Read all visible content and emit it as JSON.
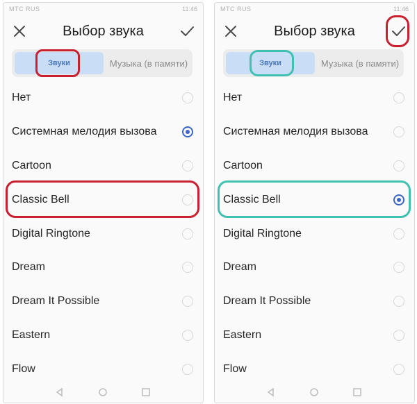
{
  "colors": {
    "accent_blue": "#3a66c9",
    "highlight_red": "#c8202f",
    "highlight_teal": "#3fc0b0",
    "tab_selected_bg": "#c9ddf6"
  },
  "screens": [
    {
      "status": {
        "left": "МТС RUS",
        "right": "11:46"
      },
      "header": {
        "title": "Выбор звука",
        "close_icon": "close-icon",
        "confirm_icon": "checkmark-icon"
      },
      "tabs": {
        "sound": "Звуки",
        "music": "Музыка (в памяти)"
      },
      "selected_item": "Системная мелодия вызова",
      "highlighted_item": "Classic Bell",
      "items": [
        {
          "label": "Нет",
          "selected": false
        },
        {
          "label": "Системная мелодия вызова",
          "selected": true
        },
        {
          "label": "Cartoon",
          "selected": false
        },
        {
          "label": "Classic Bell",
          "selected": false
        },
        {
          "label": "Digital Ringtone",
          "selected": false
        },
        {
          "label": "Dream",
          "selected": false
        },
        {
          "label": "Dream It Possible",
          "selected": false
        },
        {
          "label": "Eastern",
          "selected": false
        },
        {
          "label": "Flow",
          "selected": false
        }
      ]
    },
    {
      "status": {
        "left": "МТС RUS",
        "right": "11:46"
      },
      "header": {
        "title": "Выбор звука",
        "close_icon": "close-icon",
        "confirm_icon": "checkmark-icon"
      },
      "tabs": {
        "sound": "Звуки",
        "music": "Музыка (в памяти)"
      },
      "selected_item": "Classic Bell",
      "highlighted_item": "Classic Bell",
      "items": [
        {
          "label": "Нет",
          "selected": false
        },
        {
          "label": "Системная мелодия вызова",
          "selected": false
        },
        {
          "label": "Cartoon",
          "selected": false
        },
        {
          "label": "Classic Bell",
          "selected": true
        },
        {
          "label": "Digital Ringtone",
          "selected": false
        },
        {
          "label": "Dream",
          "selected": false
        },
        {
          "label": "Dream It Possible",
          "selected": false
        },
        {
          "label": "Eastern",
          "selected": false
        },
        {
          "label": "Flow",
          "selected": false
        }
      ]
    }
  ]
}
